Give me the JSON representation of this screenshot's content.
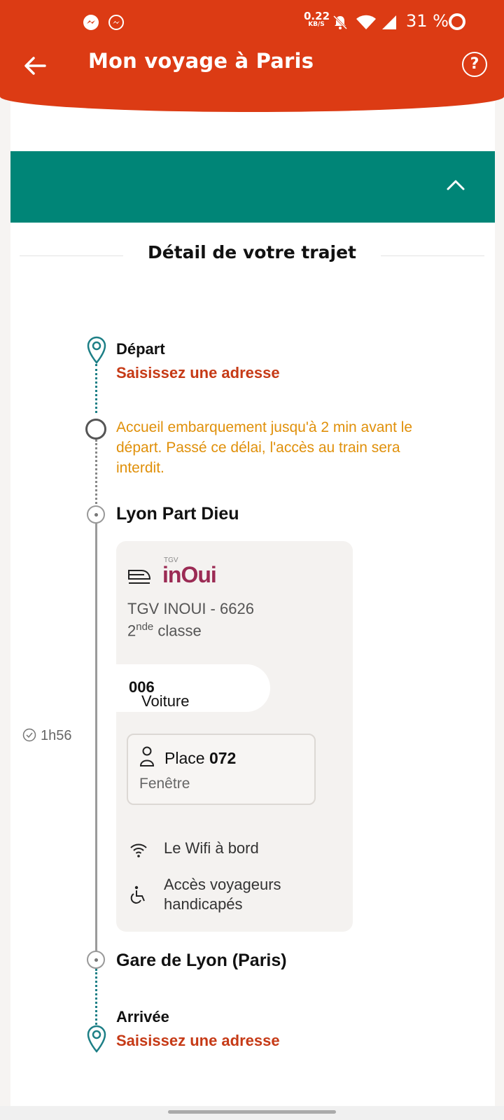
{
  "status_bar": {
    "speed_value": "0.22",
    "speed_unit": "KB/S",
    "battery": "31 %"
  },
  "header": {
    "title": "Mon voyage à Paris",
    "help_label": "?"
  },
  "section": {
    "title": "Détail de votre trajet"
  },
  "timeline": {
    "departure_label": "Départ",
    "departure_action": "Saisissez une adresse",
    "boarding_warning": "Accueil embarquement jusqu'à 2 min avant le départ. Passé ce délai, l'accès au train sera interdit.",
    "origin_station": "Lyon Part Dieu",
    "duration": "1h56",
    "destination_station": "Gare de Lyon (Paris)",
    "arrival_label": "Arrivée",
    "arrival_action": "Saisissez une adresse"
  },
  "train": {
    "brand_small": "TGV",
    "brand": "inOui",
    "name": "TGV INOUI - 6626",
    "class_prefix": "2",
    "class_sup": "nde",
    "class_suffix": " classe",
    "voiture_label": "Voiture ",
    "voiture_number": "006",
    "place_label": "Place ",
    "place_number": "072",
    "place_position": "Fenêtre",
    "amenities": [
      {
        "icon": "wifi-icon",
        "label": "Le Wifi à bord"
      },
      {
        "icon": "wheelchair-icon",
        "label": "Accès voyageurs handicapés"
      }
    ]
  },
  "colors": {
    "brand_red": "#dc3b14",
    "teal": "#008577",
    "warning_orange": "#e0900a",
    "inoui_purple": "#9b2b54"
  }
}
